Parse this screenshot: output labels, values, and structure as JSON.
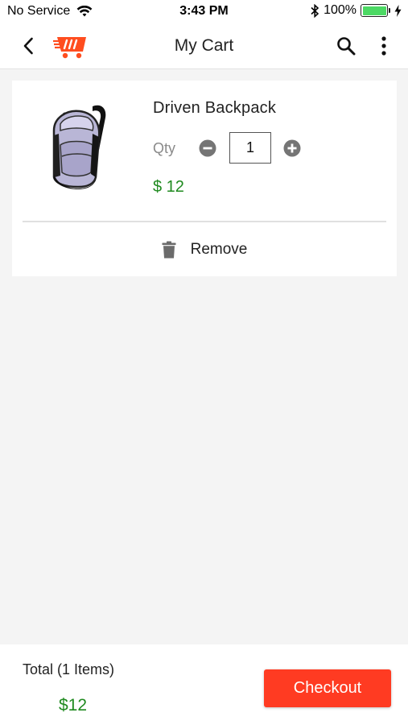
{
  "status_bar": {
    "carrier": "No Service",
    "time": "3:43 PM",
    "battery_percent": "100%",
    "battery_level": 1.0,
    "icons": [
      "wifi-icon",
      "bluetooth-icon",
      "battery-icon",
      "charging-bolt-icon"
    ]
  },
  "app_bar": {
    "title": "My Cart",
    "icons": [
      "back-arrow-icon",
      "shopping-cart-logo",
      "search-icon",
      "more-vertical-icon"
    ],
    "brand_color": "#ff4d1f"
  },
  "cart": {
    "items": [
      {
        "name": "Driven Backpack",
        "qty_label": "Qty",
        "quantity": "1",
        "price": "$ 12",
        "image": "backpack-image",
        "remove_label": "Remove"
      }
    ]
  },
  "footer": {
    "total_label": "Total (1 Items)",
    "total_value": "$12",
    "checkout_label": "Checkout",
    "checkout_color": "#ff3b22",
    "price_color": "#1f8a1f"
  }
}
